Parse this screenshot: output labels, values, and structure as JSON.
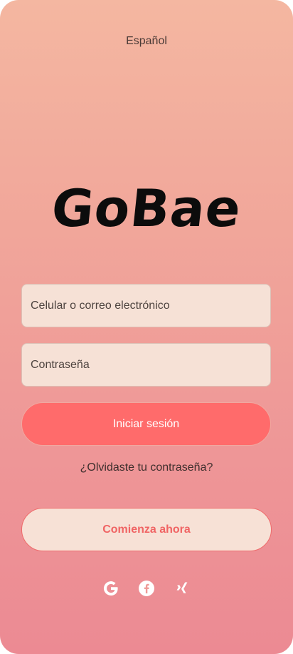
{
  "language": {
    "label": "Español"
  },
  "brand": {
    "name": "GoBae"
  },
  "login": {
    "username_placeholder": "Celular o correo electrónico",
    "password_placeholder": "Contraseña",
    "submit_label": "Iniciar sesión",
    "forgot_label": "¿Olvidaste tu contraseña?",
    "signup_label": "Comienza ahora"
  },
  "social": [
    {
      "icon": "google-icon"
    },
    {
      "icon": "facebook-icon"
    },
    {
      "icon": "xing-icon"
    }
  ],
  "colors": {
    "primary": "#ff6b6b",
    "field_bg": "#f6e1d6",
    "gradient_top": "#f4b7a1",
    "gradient_bottom": "#ec8a93"
  }
}
